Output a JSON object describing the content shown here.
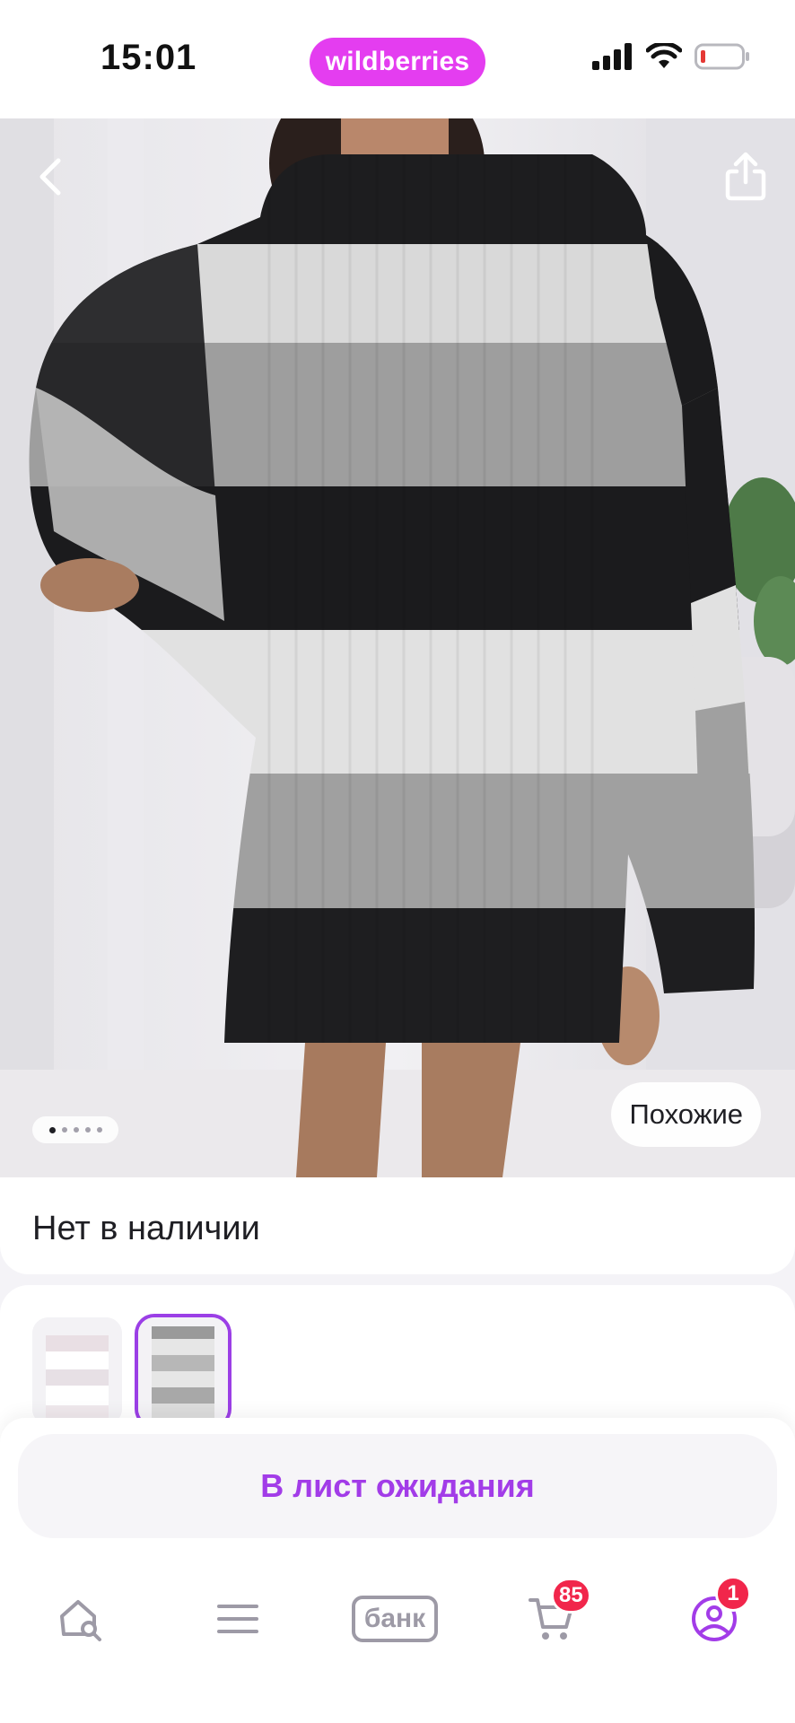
{
  "status_bar": {
    "time": "15:01",
    "brand": "wildberries",
    "signal_icon": "cellular-signal-icon",
    "wifi_icon": "wifi-icon",
    "battery_icon": "battery-low-icon",
    "battery_color": "#e53935"
  },
  "product_photo": {
    "back_icon": "chevron-left-icon",
    "share_icon": "share-icon",
    "similar_label": "Похожие",
    "image_count": 5,
    "current_image": 1
  },
  "availability": {
    "status_text": "Нет в наличии"
  },
  "variants": {
    "selected_index": 1,
    "count": 2
  },
  "actions": {
    "waitlist_label": "В лист ожидания"
  },
  "tabbar": {
    "home_icon": "home-search-icon",
    "catalog_icon": "menu-icon",
    "bank_label": "банк",
    "cart_icon": "cart-icon",
    "cart_badge": "85",
    "profile_icon": "profile-icon",
    "profile_badge": "1"
  },
  "colors": {
    "brand": "#e43df0",
    "accent": "#a23ce8",
    "badge": "#f1264b"
  }
}
